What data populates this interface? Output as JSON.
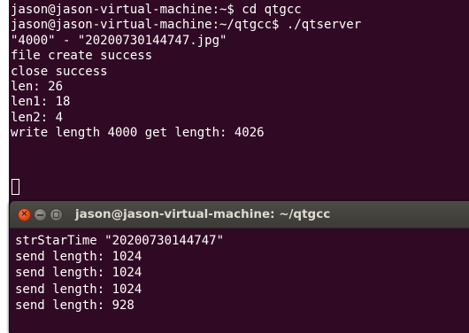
{
  "background_terminal": {
    "lines": [
      "jason@jason-virtual-machine:~$ cd qtgcc",
      "jason@jason-virtual-machine:~/qtgcc$ ./qtserver",
      "\"4000\" - \"20200730144747.jpg\"",
      "file create success",
      "close success",
      "len: 26",
      "len1: 18",
      "len2: 4",
      "write length 4000 get length: 4026"
    ]
  },
  "foreground_terminal": {
    "title": "jason@jason-virtual-machine: ~/qtgcc",
    "lines": [
      "strStarTime \"20200730144747\"",
      "send length: 1024",
      "send length: 1024",
      "send length: 1024",
      "send length: 928"
    ]
  },
  "colors": {
    "terminal_bg": "#300a24",
    "text": "#ffffff",
    "titlebar": "#3c3b37",
    "close_button": "#e0471b"
  },
  "icons": {
    "close": "close-icon",
    "minimize": "minimize-icon",
    "maximize": "maximize-icon"
  }
}
